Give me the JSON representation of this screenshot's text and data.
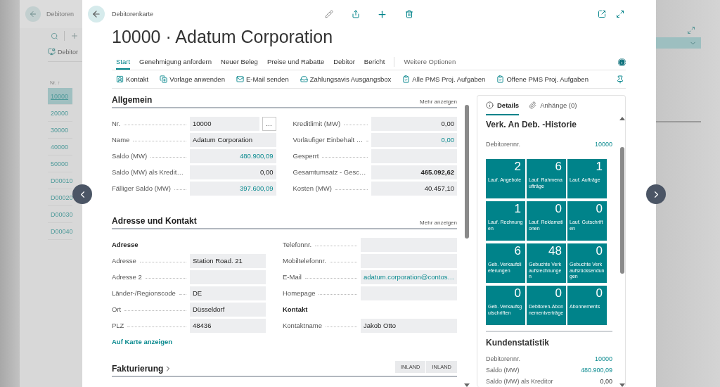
{
  "background_page": {
    "title": "Debitoren",
    "action": "Debitor",
    "column_header": "Nr. ↑",
    "rows": [
      {
        "number": "10000",
        "selected": true
      },
      {
        "number": "20000",
        "selected": false
      },
      {
        "number": "30000",
        "selected": false
      },
      {
        "number": "40000",
        "selected": false
      },
      {
        "number": "50000",
        "selected": false
      },
      {
        "number": "D00010",
        "selected": false
      },
      {
        "number": "D00020",
        "selected": false
      },
      {
        "number": "D00030",
        "selected": false
      },
      {
        "number": "D00040",
        "selected": false
      }
    ]
  },
  "card": {
    "breadcrumb": "Debitorenkarte",
    "title": "10000 · Adatum Corporation",
    "menu": [
      {
        "label": "Start",
        "selected": true
      },
      {
        "label": "Genehmigung anfordern",
        "selected": false
      },
      {
        "label": "Neuer Beleg",
        "selected": false
      },
      {
        "label": "Preise und Rabatte",
        "selected": false
      },
      {
        "label": "Debitor",
        "selected": false
      },
      {
        "label": "Bericht",
        "selected": false
      }
    ],
    "more_menu": "Weitere Optionen",
    "actions": [
      "Kontakt",
      "Vorlage anwenden",
      "E-Mail senden",
      "Zahlungsavis Ausgangsbox",
      "Alle PMS Proj. Aufgaben",
      "Offene PMS Proj. Aufgaben"
    ],
    "sections": [
      {
        "title": "Allgemein",
        "action": "Mehr anzeigen",
        "columns": [
          [
            {
              "kind": "field",
              "label": "Nr.",
              "value": "10000",
              "link": false,
              "numeric": false,
              "bold": false,
              "assist": "…"
            },
            {
              "kind": "field",
              "label": "Name",
              "value": "Adatum Corporation",
              "link": false,
              "numeric": false,
              "bold": false
            },
            {
              "kind": "field",
              "label": "Saldo (MW)",
              "value": "480.900,09",
              "link": true,
              "numeric": true,
              "bold": false
            },
            {
              "kind": "field",
              "label": "Saldo (MW) als Kredit…",
              "value": "0,00",
              "link": false,
              "numeric": true,
              "bold": false
            },
            {
              "kind": "field",
              "label": "Fälliger Saldo (MW)",
              "value": "397.600,09",
              "link": true,
              "numeric": true,
              "bold": false
            }
          ],
          [
            {
              "kind": "field",
              "label": "Kreditlimit (MW)",
              "value": "0,00",
              "link": false,
              "numeric": true,
              "bold": false
            },
            {
              "kind": "field",
              "label": "Vorläufiger Einbehalt …",
              "value": "0,00",
              "link": true,
              "numeric": true,
              "bold": false
            },
            {
              "kind": "field",
              "label": "Gesperrt"
            },
            {
              "kind": "field",
              "label": "Gesamtumsatz - Gesc…",
              "value": "465.092,62",
              "link": false,
              "numeric": true,
              "bold": true
            },
            {
              "kind": "field",
              "label": "Kosten (MW)",
              "value": "40.457,10",
              "link": false,
              "numeric": true,
              "bold": false
            }
          ]
        ]
      },
      {
        "title": "Adresse und Kontakt",
        "action": "Mehr anzeigen",
        "columns": [
          [
            {
              "kind": "heading",
              "label": "Adresse"
            },
            {
              "kind": "field",
              "label": "Adresse",
              "value": "Station Road. 21",
              "link": false,
              "numeric": false,
              "bold": false
            },
            {
              "kind": "field",
              "label": "Adresse 2"
            },
            {
              "kind": "field",
              "label": "Länder-/Regionscode",
              "value": "DE",
              "link": false,
              "numeric": false,
              "bold": false
            },
            {
              "kind": "field",
              "label": "Ort",
              "value": "Düsseldorf",
              "link": false,
              "numeric": false,
              "bold": false
            },
            {
              "kind": "field",
              "label": "PLZ",
              "value": "48436",
              "link": false,
              "numeric": false,
              "bold": false
            },
            {
              "kind": "link",
              "label": "Auf Karte anzeigen"
            }
          ],
          [
            {
              "kind": "field",
              "label": "Telefonnr."
            },
            {
              "kind": "field",
              "label": "Mobiltelefonnr."
            },
            {
              "kind": "field",
              "label": "E-Mail",
              "value": "adatum.corporation@contos…",
              "link": true,
              "numeric": false,
              "bold": false
            },
            {
              "kind": "field",
              "label": "Homepage"
            },
            {
              "kind": "heading",
              "label": "Kontakt"
            },
            {
              "kind": "field",
              "label": "Kontaktname",
              "value": "Jakob Otto",
              "link": false,
              "numeric": false,
              "bold": false
            }
          ]
        ]
      }
    ],
    "collapsed_section": {
      "title": "Fakturierung",
      "expanded": false,
      "badges": [
        "INLAND",
        "INLAND"
      ]
    }
  },
  "factbox": {
    "tabs": [
      {
        "label": "Details",
        "selected": true
      },
      {
        "label": "Anhänge (0)",
        "selected": false
      }
    ],
    "history": {
      "title": "Verk. An Deb. -Historie",
      "rows": [
        {
          "label": "Debitorennr.",
          "value": "10000",
          "link": true
        }
      ],
      "tiles": [
        {
          "value": "2",
          "label": "Lauf. Angebote"
        },
        {
          "value": "6",
          "label": "Lauf. Rahmenaufträge"
        },
        {
          "value": "1",
          "label": "Lauf. Aufträge"
        },
        {
          "value": "1",
          "label": "Lauf. Rechnungen"
        },
        {
          "value": "0",
          "label": "Lauf. Reklamationen"
        },
        {
          "value": "0",
          "label": "Lauf. Gutschriften"
        },
        {
          "value": "6",
          "label": "Geb. Verkaufslieferungen"
        },
        {
          "value": "48",
          "label": "Gebuchte Verkaufsrechnungen"
        },
        {
          "value": "0",
          "label": "Gebuchte Verkaufsrücksendungen"
        },
        {
          "value": "0",
          "label": "Geb. Verkaufsgutschriften"
        },
        {
          "value": "0",
          "label": "Debitoren-Abonnementverträge"
        },
        {
          "value": "0",
          "label": "Abonnements"
        }
      ]
    },
    "statistics": {
      "title": "Kundenstatistik",
      "rows": [
        {
          "label": "Debitorennr.",
          "value": "10000",
          "link": true
        },
        {
          "label": "Saldo (MW)",
          "value": "480.900,09",
          "link": true
        },
        {
          "label": "Saldo (MW) als Kreditor",
          "value": "0,00",
          "link": false
        }
      ]
    }
  }
}
